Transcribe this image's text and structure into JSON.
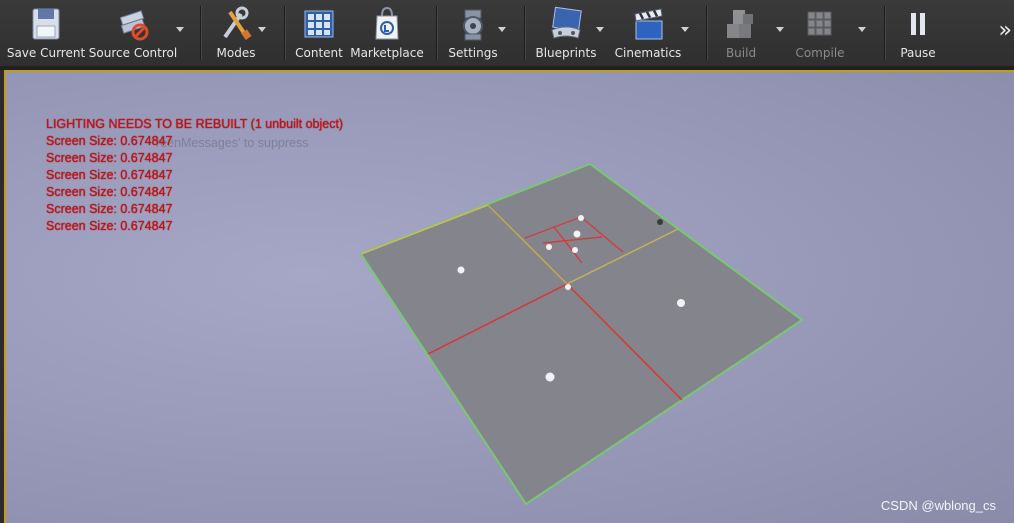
{
  "toolbar": {
    "buttons": [
      {
        "label": "Save Current",
        "icon": "save-icon"
      },
      {
        "label": "Source Control",
        "icon": "source-control-icon"
      },
      {
        "label": "Modes",
        "icon": "modes-icon"
      },
      {
        "label": "Content",
        "icon": "content-icon"
      },
      {
        "label": "Marketplace",
        "icon": "marketplace-icon"
      },
      {
        "label": "Settings",
        "icon": "settings-icon"
      },
      {
        "label": "Blueprints",
        "icon": "blueprints-icon"
      },
      {
        "label": "Cinematics",
        "icon": "cinematics-icon"
      },
      {
        "label": "Build",
        "icon": "build-icon",
        "disabled": true
      },
      {
        "label": "Compile",
        "icon": "compile-icon",
        "disabled": true
      },
      {
        "label": "Pause",
        "icon": "pause-icon"
      }
    ],
    "overflow_glyph": "»"
  },
  "viewport": {
    "messages": [
      "LIGHTING NEEDS TO BE REBUILT (1 unbuilt object)",
      "Screen Size: 0.674847",
      "Screen Size: 0.674847",
      "Screen Size: 0.674847",
      "Screen Size: 0.674847",
      "Screen Size: 0.674847",
      "Screen Size: 0.674847"
    ],
    "ghost_message": "reenMessages' to suppress",
    "message_color": "#d40c0c",
    "border_color": "#c99a18"
  },
  "watermark": "CSDN @wblong_cs"
}
